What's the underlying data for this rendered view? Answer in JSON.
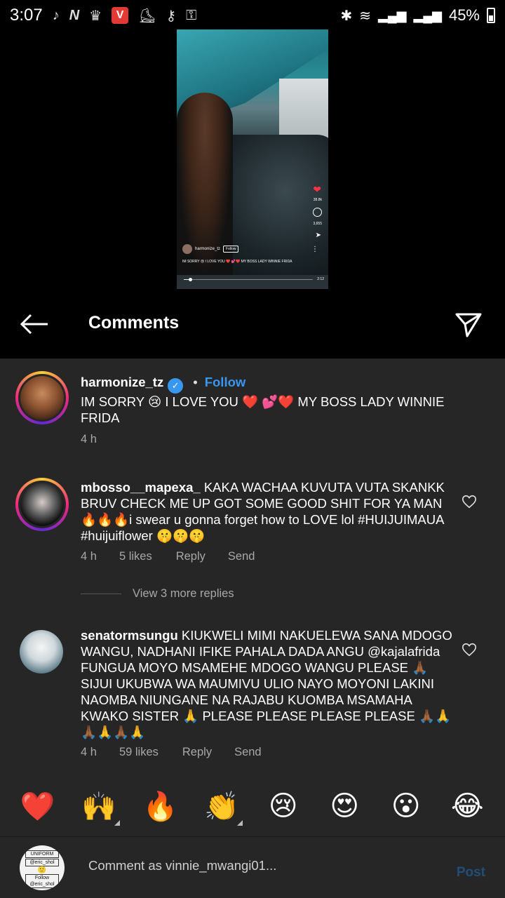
{
  "status_bar": {
    "time": "3:07",
    "battery": "45%",
    "notification_icons": [
      "music-note",
      "netflix-n",
      "premier-league",
      "v-app",
      "sneaker",
      "key-satellite",
      "key"
    ]
  },
  "video": {
    "likes": "38.8k",
    "comments": "3,655",
    "username": "harmonize_tz",
    "follow_label": "Follow",
    "caption": "IM SORRY 😢 I LOVE YOU ❤️ 💕❤️ MY BOSS LADY WINNIE FRIDA",
    "duration": "2:12",
    "progress": 0.05
  },
  "header": {
    "title": "Comments"
  },
  "post": {
    "username": "harmonize_tz",
    "follow_label": "Follow",
    "text": "IM SORRY 😢 I LOVE YOU ❤️ 💕❤️ MY BOSS LADY WINNIE FRIDA",
    "time": "4 h"
  },
  "comments": [
    {
      "username": "mbosso__mapexa_",
      "text": "KAKA WACHAA KUVUTA VUTA SKANKK BRUV CHECK ME UP GOT SOME GOOD SHIT FOR YA MAN🔥🔥🔥i swear u gonna forget how to LOVE lol #HUIJUIMAUA #huijuiflower 🤫🤫🤫",
      "time": "4 h",
      "likes": "5 likes",
      "reply_label": "Reply",
      "send_label": "Send",
      "view_replies": "View 3 more replies"
    },
    {
      "username": "senatormsungu",
      "text": "KIUKWELI MIMI NAKUELEWA SANA MDOGO WANGU, NADHANI IFIKE PAHALA DADA ANGU @kajalafrida FUNGUA MOYO MSAMEHE MDOGO WANGU PLEASE 🙏🏾 SIJUI UKUBWA WA MAUMIVU ULIO NAYO MOYONI LAKINI NAOMBA NIUNGANE NA RAJABU KUOMBA MSAMAHA KWAKO SISTER 🙏 PLEASE PLEASE PLEASE PLEASE 🙏🏾🙏🙏🏾🙏🙏🏾🙏",
      "time": "4 h",
      "likes": "59 likes",
      "reply_label": "Reply",
      "send_label": "Send"
    }
  ],
  "emoji_bar": [
    "❤️",
    "🙌",
    "🔥",
    "👏",
    "😢",
    "😍",
    "😮",
    "😂"
  ],
  "input": {
    "placeholder": "Comment as vinnie_mwangi01...",
    "post_label": "Post",
    "avatar_lines": [
      "UNIFORM",
      "@eric_shol",
      "Follow @eric_shol"
    ]
  }
}
